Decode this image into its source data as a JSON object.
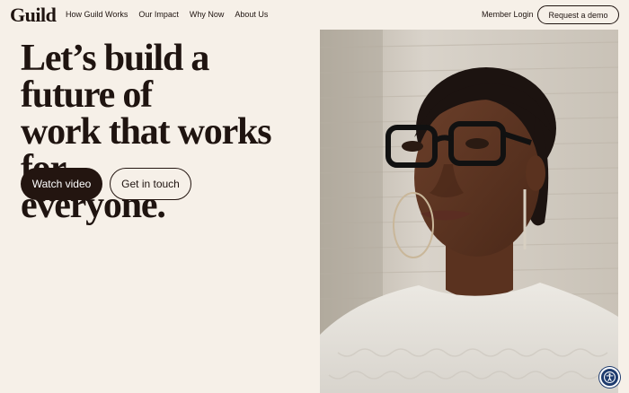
{
  "brand": {
    "logo_text": "Guild"
  },
  "nav": {
    "items": [
      {
        "label": "How Guild Works"
      },
      {
        "label": "Our Impact"
      },
      {
        "label": "Why Now"
      },
      {
        "label": "About Us"
      }
    ],
    "member_login": "Member Login",
    "request_demo": "Request a demo"
  },
  "hero": {
    "headline_lines": [
      "Let’s build a future of",
      "work that works for",
      "everyone."
    ],
    "watch_video": "Watch video",
    "get_in_touch": "Get in touch"
  },
  "colors": {
    "background": "#f6f0e8",
    "primary_dark": "#231510",
    "accessibility_blue": "#1e3b6e"
  },
  "icons": {
    "accessibility": "accessibility-person-icon"
  }
}
